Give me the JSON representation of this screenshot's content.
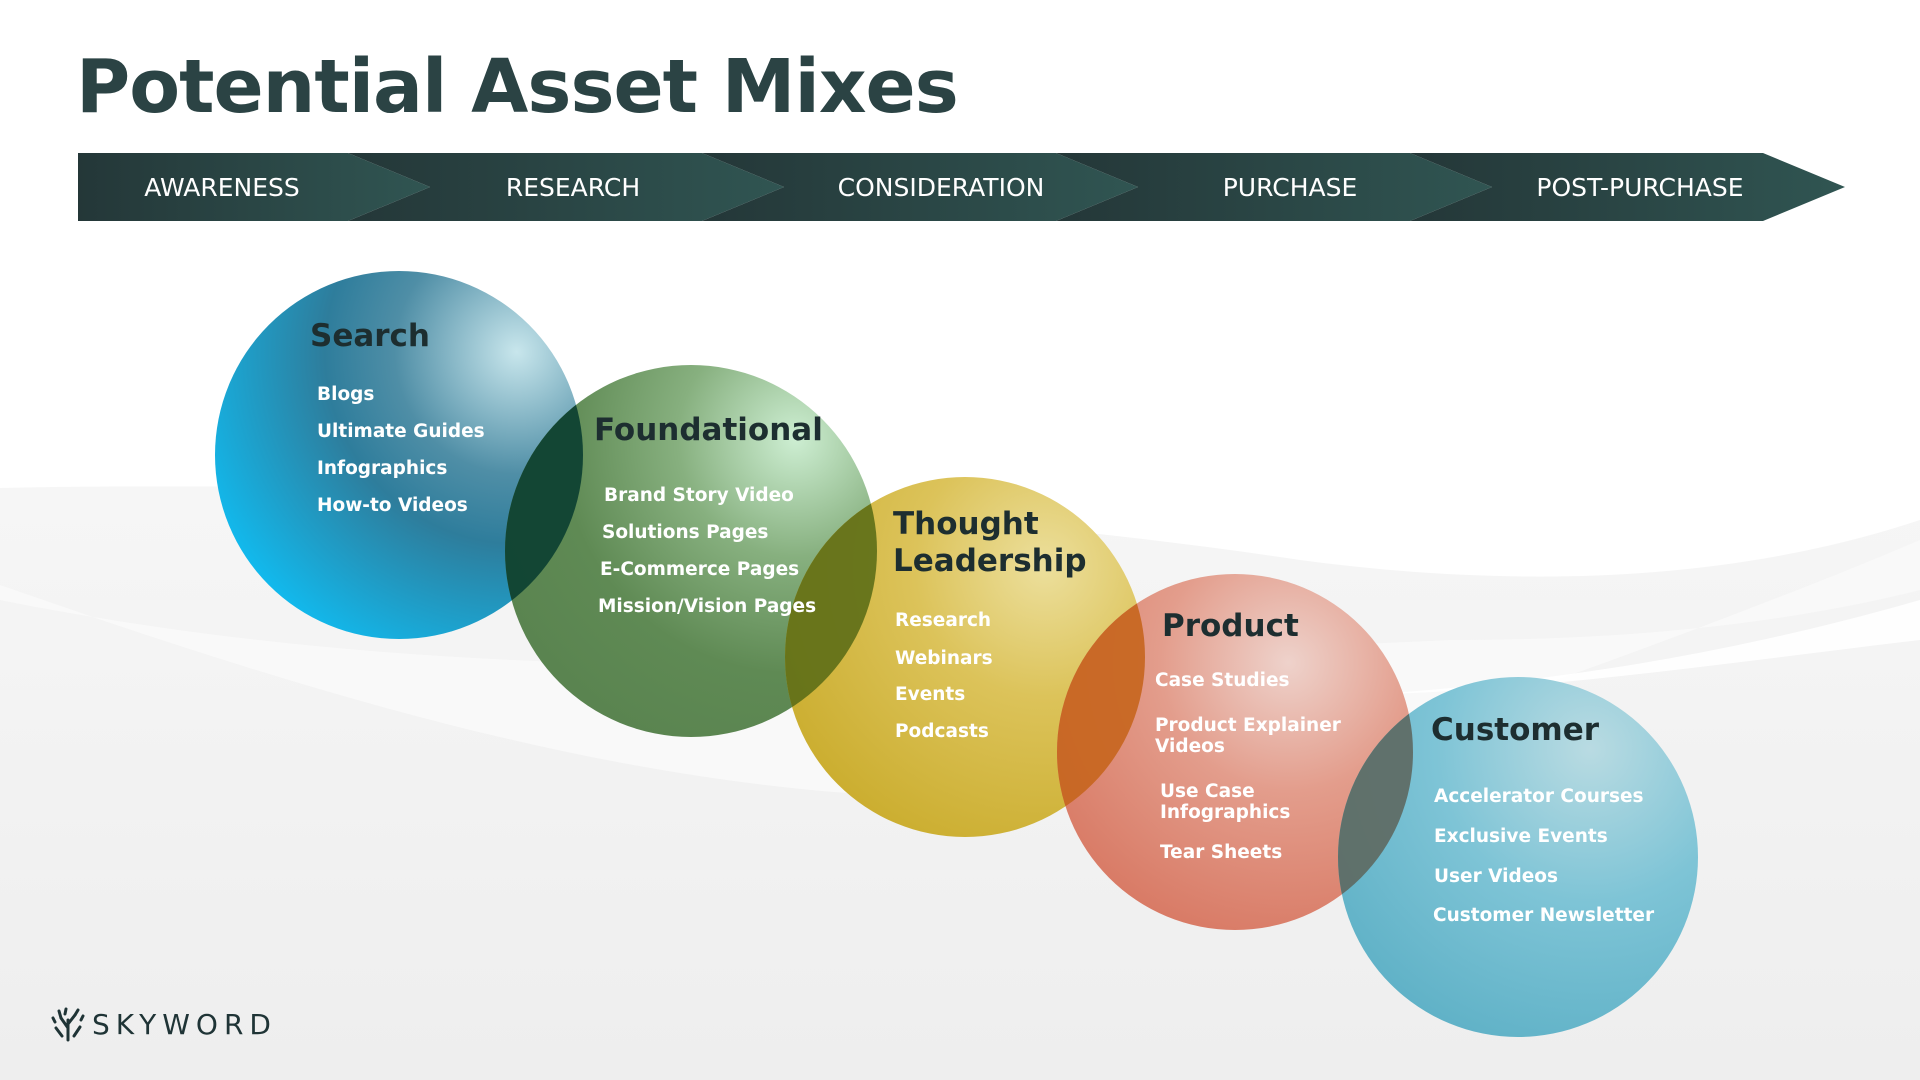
{
  "title": "Potential Asset Mixes",
  "stages": [
    "AWARENESS",
    "RESEARCH",
    "CONSIDERATION",
    "PURCHASE",
    "POST-PURCHASE"
  ],
  "circles": [
    {
      "title_lines": [
        "Search"
      ],
      "items": [
        [
          "Blogs"
        ],
        [
          "Ultimate Guides"
        ],
        [
          "Infographics"
        ],
        [
          "How-to Videos"
        ]
      ],
      "color": "#1aa3d1"
    },
    {
      "title_lines": [
        "Foundational"
      ],
      "items": [
        [
          "Brand Story Video"
        ],
        [
          "Solutions Pages"
        ],
        [
          "E-Commerce Pages"
        ],
        [
          "Mission/Vision Pages"
        ]
      ],
      "color": "#5e8a52"
    },
    {
      "title_lines": [
        "Thought",
        "Leadership"
      ],
      "items": [
        [
          "Research"
        ],
        [
          "Webinars"
        ],
        [
          "Events"
        ],
        [
          "Podcasts"
        ]
      ],
      "color": "#d2b52e"
    },
    {
      "title_lines": [
        "Product"
      ],
      "items": [
        [
          "Case Studies"
        ],
        [
          "Product Explainer",
          "Videos"
        ],
        [
          "Use Case",
          "Infographics"
        ],
        [
          "Tear Sheets"
        ]
      ],
      "color": "#dc7a66"
    },
    {
      "title_lines": [
        "Customer"
      ],
      "items": [
        [
          "Accelerator Courses"
        ],
        [
          "Exclusive Events"
        ],
        [
          "User Videos"
        ],
        [
          "Customer Newsletter"
        ]
      ],
      "color": "#6bbfd4"
    }
  ],
  "logo": {
    "wordmark": "SKYWORD",
    "icon": "skyword-tree-icon"
  },
  "colors": {
    "title": "#2b4344",
    "bar_dark": "#243738",
    "bar_light": "#305552",
    "circle_heading": "#1d2e30"
  }
}
